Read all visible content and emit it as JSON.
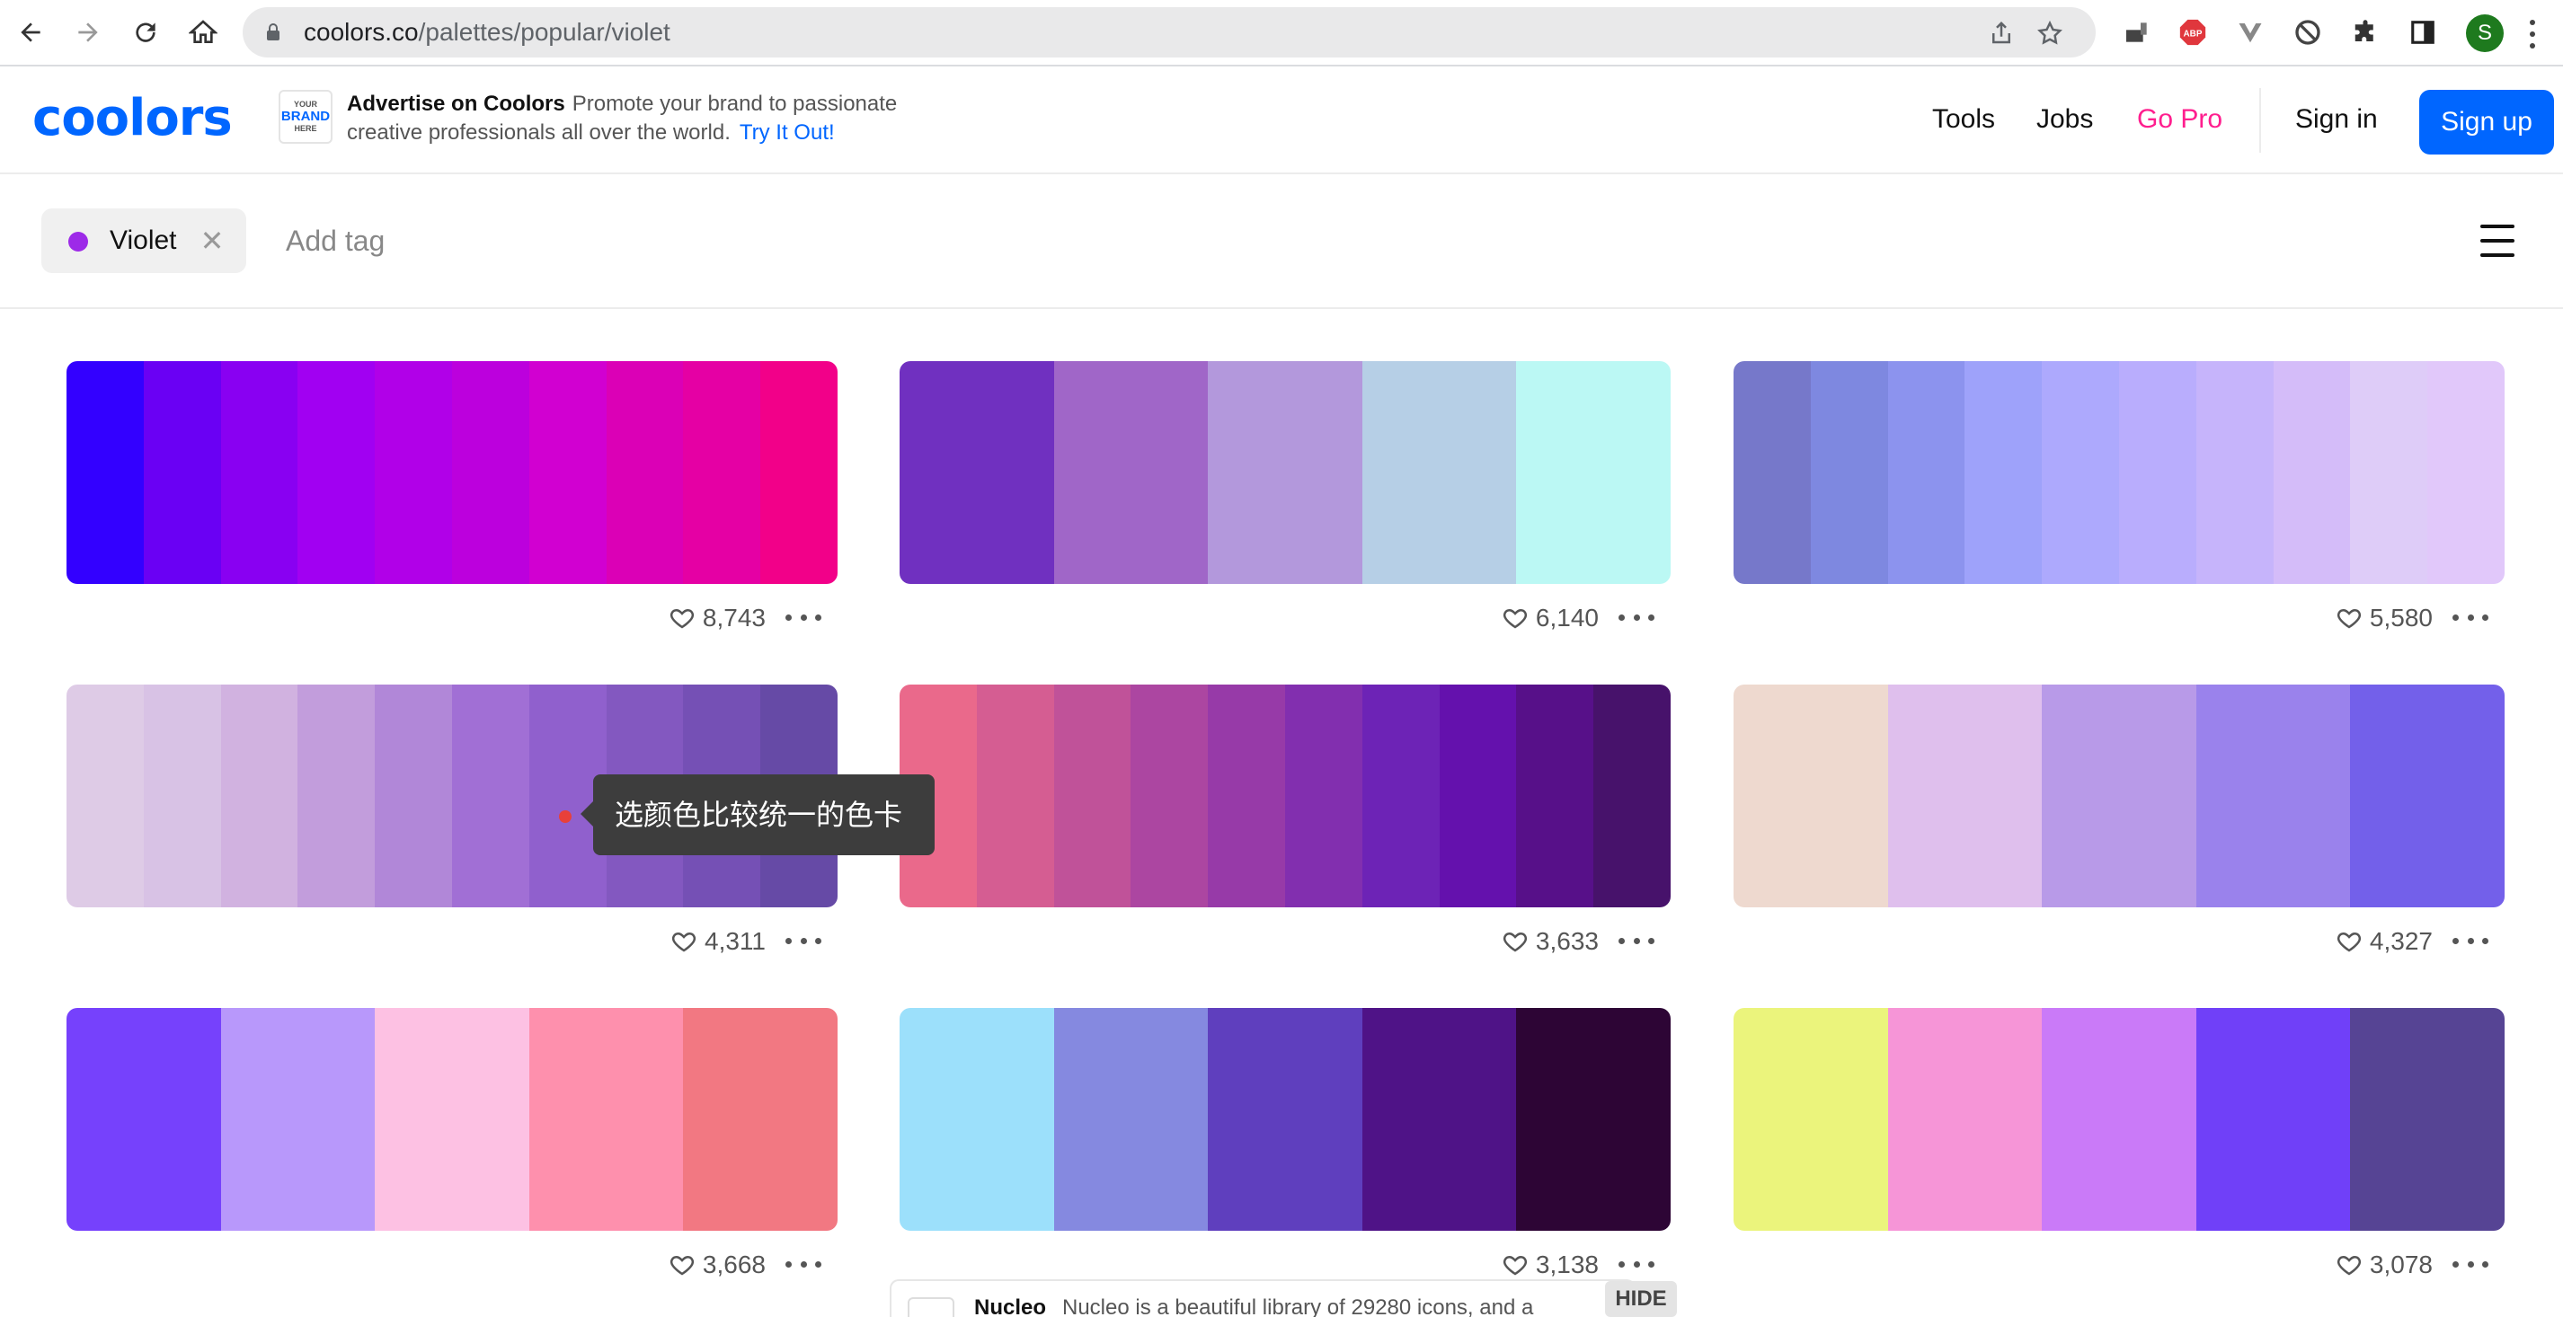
{
  "browser": {
    "url_host": "coolors.co",
    "url_path": "/palettes/popular/violet",
    "profile_initial": "S"
  },
  "header": {
    "logo_text": "coolors",
    "ad_badge": [
      "YOUR",
      "BRAND",
      "HERE"
    ],
    "ad_title": "Advertise on Coolors",
    "ad_body": "Promote your brand to passionate creative professionals all over the world.",
    "ad_link": "Try It Out!",
    "nav": [
      "Tools",
      "Jobs",
      "Go Pro"
    ],
    "sign_in": "Sign in",
    "sign_up": "Sign up"
  },
  "tagbar": {
    "active_tag": "Violet",
    "active_tag_color": "#9d2ae8",
    "add_tag_placeholder": "Add tag"
  },
  "palettes": [
    {
      "colors": [
        "#3300ff",
        "#6a00f4",
        "#8900f2",
        "#a100f2",
        "#b100e8",
        "#bc00dd",
        "#d100d1",
        "#db00b6",
        "#e500a4",
        "#f20089"
      ],
      "likes": "8,743"
    },
    {
      "colors": [
        "#7030c0",
        "#a066c8",
        "#b398dc",
        "#b6cfe6",
        "#bbf8f4"
      ],
      "likes": "6,140"
    },
    {
      "colors": [
        "#7678ca",
        "#7e88e0",
        "#8c93ee",
        "#9ea2fa",
        "#ada9fd",
        "#b9adfd",
        "#c6b4fb",
        "#d4bcf9",
        "#deccf8",
        "#e1c8fa"
      ],
      "likes": "5,580"
    },
    {
      "colors": [
        "#decbe6",
        "#d8c2e5",
        "#d1b2e0",
        "#c29ddc",
        "#b187d8",
        "#a16fd5",
        "#9060cd",
        "#8358c0",
        "#7550b5",
        "#664aa6"
      ],
      "likes": "4,311"
    },
    {
      "colors": [
        "#ea698b",
        "#d55d92",
        "#c05299",
        "#ac46a1",
        "#973aa8",
        "#822faf",
        "#6d23b6",
        "#6411ad",
        "#571089",
        "#47126b"
      ],
      "likes": "3,633"
    },
    {
      "colors": [
        "#eed9cf",
        "#dfbfed",
        "#b89ae8",
        "#9a82ec",
        "#7360ea"
      ],
      "likes": "4,327"
    },
    {
      "colors": [
        "#7641fc",
        "#b898fb",
        "#fdc1e3",
        "#fe90ad",
        "#f27882"
      ],
      "likes": "3,668"
    },
    {
      "colors": [
        "#9ce0fb",
        "#8589e0",
        "#5f3fbe",
        "#4f1387",
        "#2d0535"
      ],
      "likes": "3,138"
    },
    {
      "colors": [
        "#ebf47c",
        "#f695d7",
        "#ca7af8",
        "#7040f8",
        "#564494"
      ],
      "likes": "3,078"
    }
  ],
  "tooltip": {
    "text": "选颜色比较统一的色卡"
  },
  "bottom_ad": {
    "name": "Nucleo",
    "description": "Nucleo is a beautiful library of 29280 icons, and a",
    "hide_label": "HIDE"
  }
}
